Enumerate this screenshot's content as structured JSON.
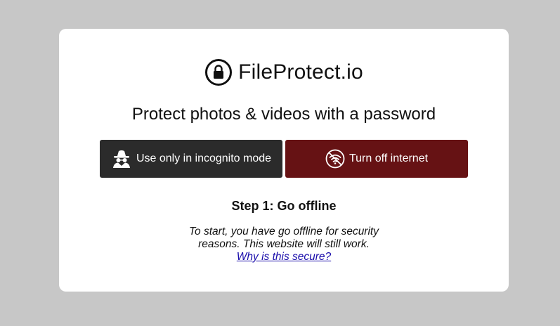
{
  "brand": {
    "name": "FileProtect.io",
    "icon": "lock-circle-icon"
  },
  "tagline": "Protect photos & videos with a password",
  "buttons": {
    "incognito": {
      "label": "Use only in incognito mode",
      "icon": "incognito-spy-icon",
      "color": "#2b2b2b"
    },
    "offline": {
      "label": "Turn off internet",
      "icon": "wifi-off-icon",
      "color": "#661214"
    }
  },
  "step": {
    "title": "Step 1: Go offline",
    "description": "To start, you have go offline for security reasons. This website will still work.",
    "link_label": "Why is this secure?"
  },
  "colors": {
    "page_background": "#c7c7c7",
    "card_background": "#ffffff",
    "link": "#1a0dab"
  }
}
